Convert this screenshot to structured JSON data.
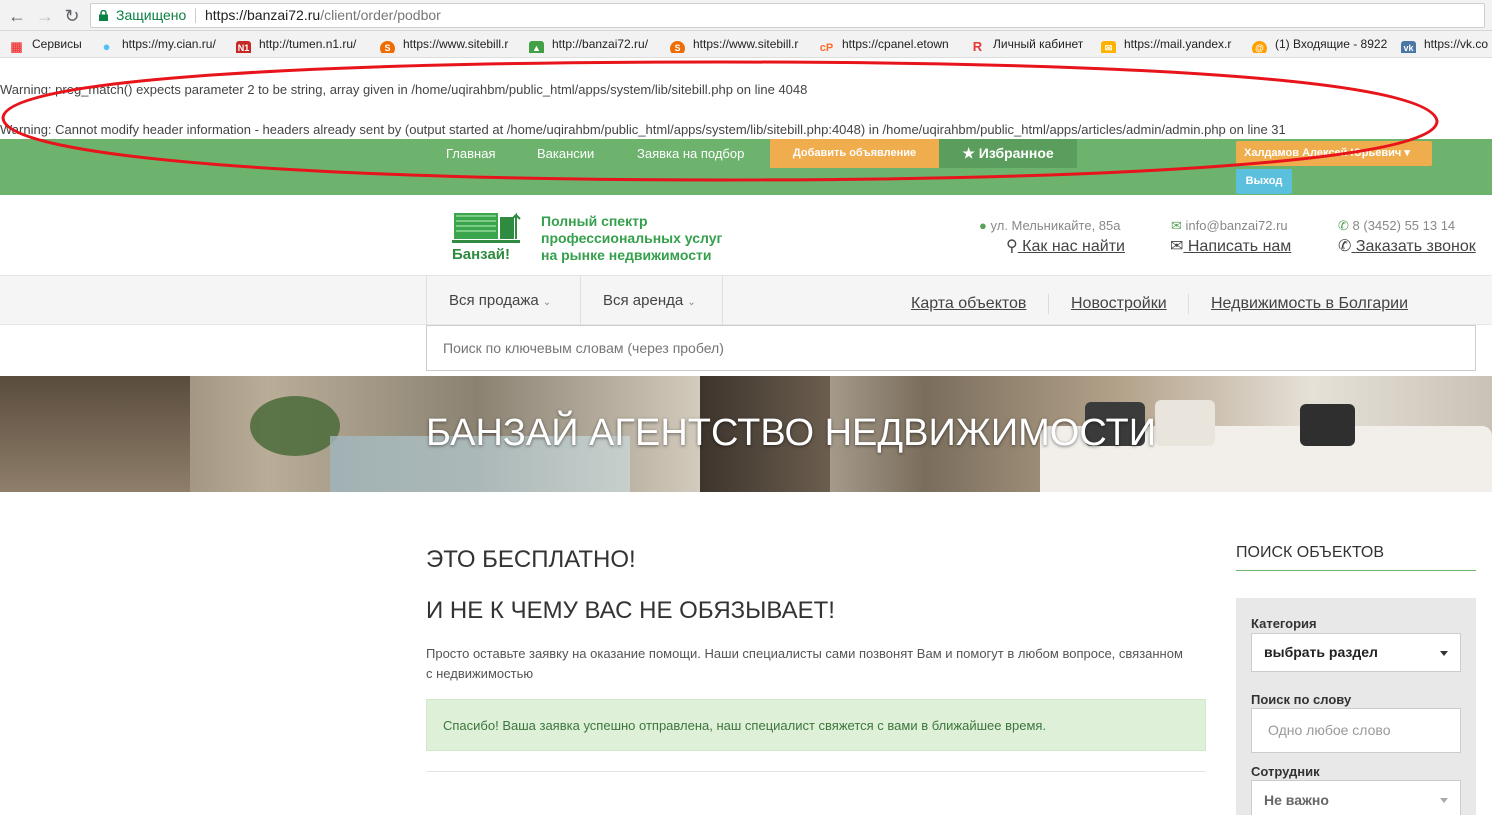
{
  "browser": {
    "secure_label": "Защищено",
    "url_host": "https://banzai72.ru",
    "url_path": "/client/order/podbor",
    "bookmarks": [
      {
        "icon": "apps-grid-icon",
        "label": "Сервисы"
      },
      {
        "icon": "cian-pin-icon",
        "label": "https://my.cian.ru/"
      },
      {
        "icon": "n1-icon",
        "label": "http://tumen.n1.ru/"
      },
      {
        "icon": "sitebill-icon",
        "label": "https://www.sitebill.r"
      },
      {
        "icon": "banzai-site-icon",
        "label": "http://banzai72.ru/"
      },
      {
        "icon": "sitebill-icon",
        "label": "https://www.sitebill.r"
      },
      {
        "icon": "cpanel-icon",
        "label": "https://cpanel.etown"
      },
      {
        "icon": "yandex-r-icon",
        "label": "Личный кабинет"
      },
      {
        "icon": "mail-envelope-icon",
        "label": "https://mail.yandex.r"
      },
      {
        "icon": "inbox-icon",
        "label": "(1) Входящие - 8922"
      },
      {
        "icon": "vk-icon",
        "label": "https://vk.co"
      }
    ]
  },
  "warnings": [
    "Warning: preg_match() expects parameter 2 to be string, array given in /home/uqirahbm/public_html/apps/system/lib/sitebill.php on line 4048",
    "Warning: Cannot modify header information - headers already sent by (output started at /home/uqirahbm/public_html/apps/system/lib/sitebill.php:4048) in /home/uqirahbm/public_html/apps/articles/admin/admin.php on line 31"
  ],
  "topnav": {
    "home": "Главная",
    "vacancies": "Вакансии",
    "selection_request": "Заявка на подбор",
    "add_ad": "Добавить объявление",
    "favorites": "Избранное",
    "user_name": "Халдамов Алексей Юрьевич",
    "logout": "Выход"
  },
  "header": {
    "logo_text": "Банзай!",
    "tagline_1": "Полный спектр",
    "tagline_2": "профессиональных услуг",
    "tagline_3": "на рынке недвижимости",
    "address": "ул. Мельникайте, 85а",
    "find_us": "Как нас найти",
    "email": "info@banzai72.ru",
    "write_us": "Написать нам",
    "phone": "8 (3452) 55 13 14",
    "order_call": "Заказать звонок"
  },
  "secnav": {
    "all_sale": "Вся продажа",
    "all_rent": "Вся аренда",
    "map": "Карта объектов",
    "new_buildings": "Новостройки",
    "bulgaria": "Недвижимость в Болгарии"
  },
  "search": {
    "placeholder": "Поиск по ключевым словам (через пробел)"
  },
  "hero": {
    "title": "БАНЗАЙ АГЕНТСТВО НЕДВИЖИМОСТИ"
  },
  "main": {
    "heading_1": "ЭТО БЕСПЛАТНО!",
    "heading_2": "И НЕ К ЧЕМУ ВАС НЕ ОБЯЗЫВАЕТ!",
    "intro": "Просто оставьте заявку на оказание помощи. Наши специалисты сами позвонят Вам и помогут в любом вопросе, связанном с недвижимостью",
    "success_message": "Спасибо! Ваша заявка успешно отправлена, наш специалист свяжется с вами в ближайшее время."
  },
  "sidebar": {
    "title": "ПОИСК ОБЪЕКТОВ",
    "category_label": "Категория",
    "category_value": "выбрать раздел",
    "word_label": "Поиск по слову",
    "word_placeholder": "Одно любое слово",
    "employee_label": "Сотрудник",
    "employee_value": "Не важно"
  },
  "colors": {
    "green": "#6db36e",
    "orange": "#f0ad4e",
    "annotation_red": "#e8141b"
  }
}
